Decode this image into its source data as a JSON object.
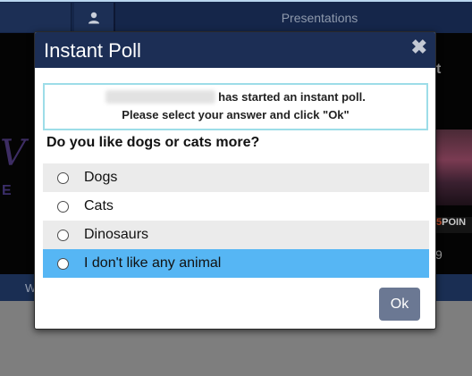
{
  "background": {
    "topbar_tab": "Presentations",
    "user_icon": "user-icon",
    "stage_fragments": {
      "right_letter": "t",
      "logo_letter": "V",
      "e_letter": "E",
      "poi_text": "POIN",
      "poi_prefix": "5",
      "number": "9"
    },
    "nav_fragment": "W"
  },
  "modal": {
    "title": "Instant Poll",
    "close_icon": "close-icon",
    "notice": {
      "line1": "has started an instant poll.",
      "line2": "Please select your answer and click \"Ok\""
    },
    "question": "Do you like dogs or cats more?",
    "options": [
      {
        "label": "Dogs"
      },
      {
        "label": "Cats"
      },
      {
        "label": "Dinosaurs"
      },
      {
        "label": "I don't like any animal"
      }
    ],
    "ok_label": "Ok"
  },
  "colors": {
    "header_bg": "#1c2e55",
    "selected_row": "#56b6f4",
    "ok_button": "#6b7893",
    "notice_border": "#9ddde8"
  }
}
